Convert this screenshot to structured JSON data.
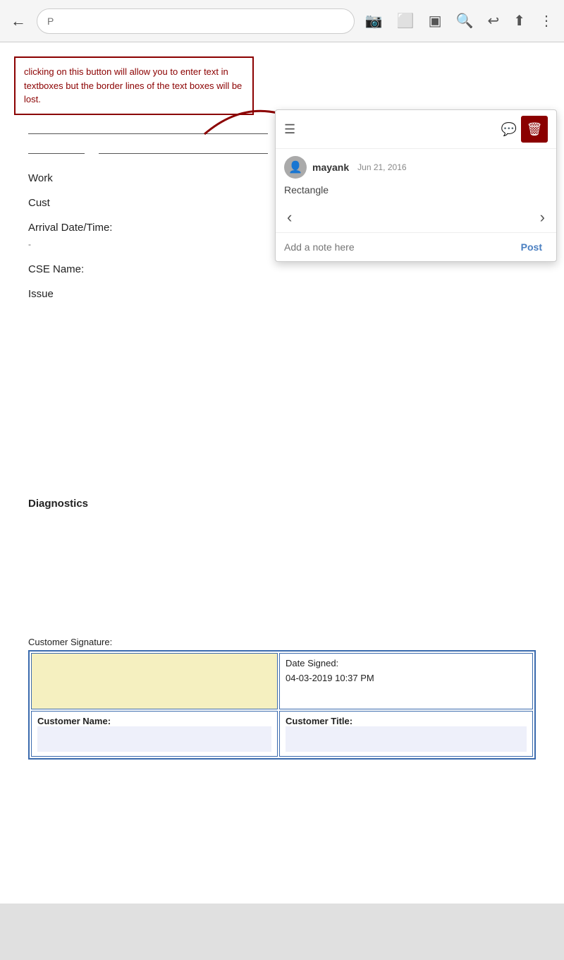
{
  "browser": {
    "back_label": "←",
    "url_value": "",
    "url_placeholder": "P",
    "icons": [
      "📷",
      "⬜",
      "⬛",
      "🔍",
      "↩",
      "⬆",
      "⋮"
    ]
  },
  "warning": {
    "text": "clicking on this button will allow you to enter text in textboxes but the border lines of the text boxes will be lost."
  },
  "form": {
    "work_label": "Work",
    "cust_label": "Cust",
    "arrival_label": "Arrival Date/Time:",
    "cse_label": "CSE Name:",
    "issue_label": "Issue",
    "diagnostics_label": "Diagnostics"
  },
  "signature": {
    "label": "Customer Signature:",
    "date_signed_label": "Date Signed:",
    "date_value": "04-03-2019 10:37 PM",
    "customer_name_label": "Customer Name:",
    "customer_title_label": "Customer Title:"
  },
  "popup": {
    "list_icon": "☰",
    "comment_icon": "💬",
    "delete_icon": "🗑",
    "username": "mayank",
    "date": "Jun 21, 2016",
    "annotation_type": "Rectangle",
    "prev_arrow": "‹",
    "next_arrow": "›",
    "note_placeholder": "Add a note here",
    "post_button": "Post"
  }
}
